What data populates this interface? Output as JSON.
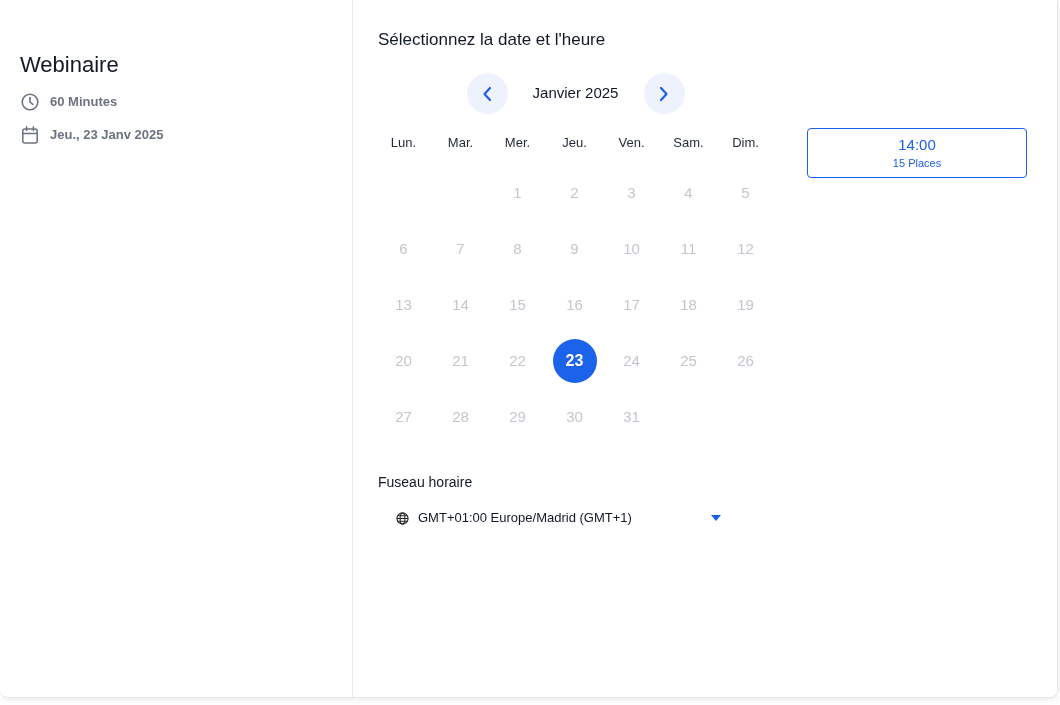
{
  "event": {
    "title": "Webinaire",
    "details": [
      {
        "kind": "duration",
        "text": "60 Minutes"
      },
      {
        "kind": "date",
        "text": "Jeu., 23 Janv 2025"
      }
    ]
  },
  "heading": "Sélectionnez la date et l'heure",
  "calendar": {
    "month": "Janvier 2025",
    "weekdays": [
      "Lun.",
      "Mar.",
      "Mer.",
      "Jeu.",
      "Ven.",
      "Sam.",
      "Dim."
    ],
    "weeks": [
      [
        {
          "label": "1",
          "selected": false,
          "disabled": true
        },
        {
          "label": "2",
          "selected": false,
          "disabled": true
        },
        {
          "label": "3",
          "selected": false,
          "disabled": true
        },
        {
          "label": "4",
          "selected": false,
          "disabled": true
        },
        {
          "label": "5",
          "selected": false,
          "disabled": true
        }
      ],
      [
        {
          "label": "6",
          "selected": false,
          "disabled": true
        },
        {
          "label": "7",
          "selected": false,
          "disabled": true
        },
        {
          "label": "8",
          "selected": false,
          "disabled": true
        },
        {
          "label": "9",
          "selected": false,
          "disabled": true
        },
        {
          "label": "10",
          "selected": false,
          "disabled": true
        },
        {
          "label": "11",
          "selected": false,
          "disabled": true
        },
        {
          "label": "12",
          "selected": false,
          "disabled": true
        }
      ],
      [
        {
          "label": "13",
          "selected": false,
          "disabled": true
        },
        {
          "label": "14",
          "selected": false,
          "disabled": true
        },
        {
          "label": "15",
          "selected": false,
          "disabled": true
        },
        {
          "label": "16",
          "selected": false,
          "disabled": true
        },
        {
          "label": "17",
          "selected": false,
          "disabled": true
        },
        {
          "label": "18",
          "selected": false,
          "disabled": true
        },
        {
          "label": "19",
          "selected": false,
          "disabled": true
        }
      ],
      [
        {
          "label": "20",
          "selected": false,
          "disabled": true
        },
        {
          "label": "21",
          "selected": false,
          "disabled": true
        },
        {
          "label": "22",
          "selected": false,
          "disabled": true
        },
        {
          "label": "23",
          "selected": true,
          "disabled": false
        },
        {
          "label": "24",
          "selected": false,
          "disabled": true
        },
        {
          "label": "25",
          "selected": false,
          "disabled": true
        },
        {
          "label": "26",
          "selected": false,
          "disabled": true
        }
      ],
      [
        {
          "label": "27",
          "selected": false,
          "disabled": true
        },
        {
          "label": "28",
          "selected": false,
          "disabled": true
        },
        {
          "label": "29",
          "selected": false,
          "disabled": true
        },
        {
          "label": "30",
          "selected": false,
          "disabled": true
        },
        {
          "label": "31",
          "selected": false,
          "disabled": true
        }
      ]
    ]
  },
  "time_slots": [
    {
      "time": "14:00",
      "places": "15 Places",
      "selected": false
    }
  ],
  "timezone": {
    "label": "Fuseau horaire",
    "value": "GMT+01:00 Europe/Madrid (GMT+1)"
  }
}
